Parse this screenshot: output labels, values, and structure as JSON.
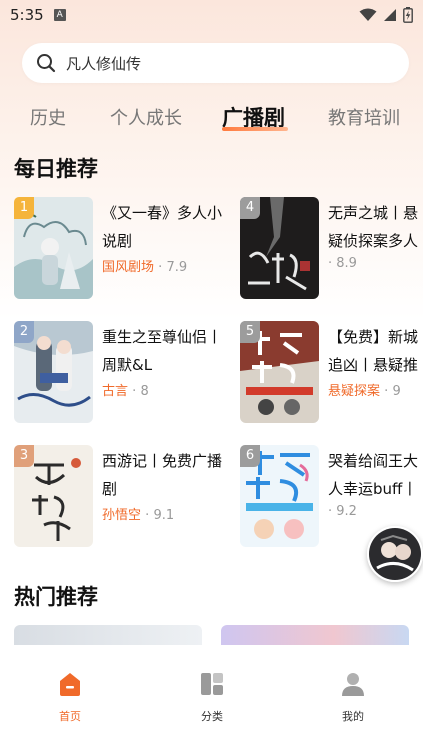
{
  "status": {
    "time": "5:35",
    "a_icon": "A"
  },
  "search": {
    "placeholder": "凡人修仙传"
  },
  "tabs": [
    {
      "label": "历史",
      "active": false
    },
    {
      "label": "个人成长",
      "active": false
    },
    {
      "label": "广播剧",
      "active": true
    },
    {
      "label": "教育培训",
      "active": false
    }
  ],
  "daily": {
    "title": "每日推荐",
    "items": [
      {
        "rank": "1",
        "title": "《又一春》多人小说剧",
        "tag": "国风剧场",
        "score": "7.9",
        "rank_color": "#f5b43b"
      },
      {
        "rank": "2",
        "title": "重生之至尊仙侣丨周默&L",
        "tag": "古言",
        "score": "8",
        "rank_color": "#8fa6c8"
      },
      {
        "rank": "3",
        "title": "西游记丨免费广播剧",
        "tag": "孙悟空",
        "score": "9.1",
        "rank_color": "#e0a07a"
      },
      {
        "rank": "4",
        "title": "无声之城丨悬疑侦探案多人有声剧",
        "tag": "",
        "score": "8.9",
        "rank_color": "#9c9c9c"
      },
      {
        "rank": "5",
        "title": "【免费】新城追凶丨悬疑推理",
        "tag": "悬疑探案",
        "score": "9",
        "rank_color": "#9c9c9c"
      },
      {
        "rank": "6",
        "title": "哭着给阎王大人幸运buff丨免费",
        "tag": "",
        "score": "9.2",
        "rank_color": "#9c9c9c"
      }
    ],
    "meta_sep": "·"
  },
  "hot": {
    "title": "热门推荐"
  },
  "bottom_nav": [
    {
      "label": "首页",
      "icon": "home-icon",
      "active": true
    },
    {
      "label": "分类",
      "icon": "category-icon",
      "active": false
    },
    {
      "label": "我的",
      "icon": "profile-icon",
      "active": false
    }
  ],
  "colors": {
    "accent": "#f06a2a",
    "tag": "#f06a2a"
  }
}
